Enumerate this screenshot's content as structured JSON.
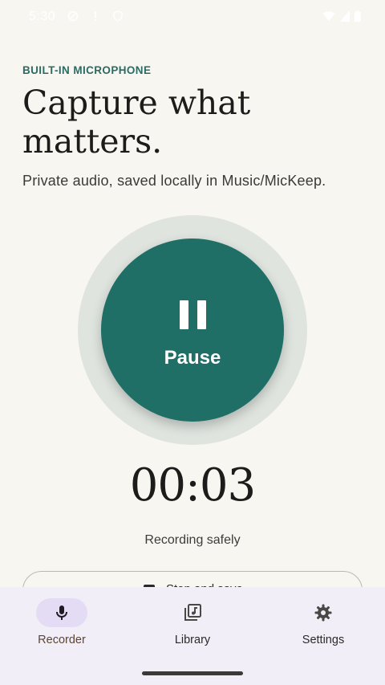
{
  "status_bar": {
    "time": "5:30",
    "left_icons": [
      "do-not-disturb-icon",
      "alert-icon",
      "shield-icon"
    ],
    "right_icons": [
      "wifi-icon",
      "signal-icon",
      "battery-icon"
    ]
  },
  "header": {
    "eyebrow": "BUILT-IN MICROPHONE",
    "headline": "Capture what matters.",
    "subtitle": "Private audio, saved locally in Music/MicKeep."
  },
  "recorder": {
    "button_label": "Pause",
    "button_icon": "pause-icon",
    "timer": "00:03",
    "status": "Recording safely",
    "stop_label": "Stop and save",
    "stop_icon": "stop-icon"
  },
  "bottom_nav": {
    "items": [
      {
        "label": "Recorder",
        "icon": "mic-icon",
        "active": true
      },
      {
        "label": "Library",
        "icon": "library-music-icon",
        "active": false
      },
      {
        "label": "Settings",
        "icon": "gear-icon",
        "active": false
      }
    ]
  },
  "colors": {
    "background": "#f8f6f1",
    "accent": "#1f6f66",
    "halo": "#dfe4df",
    "nav_background": "#f2eef8",
    "nav_active_pill": "#e4dcf5"
  }
}
